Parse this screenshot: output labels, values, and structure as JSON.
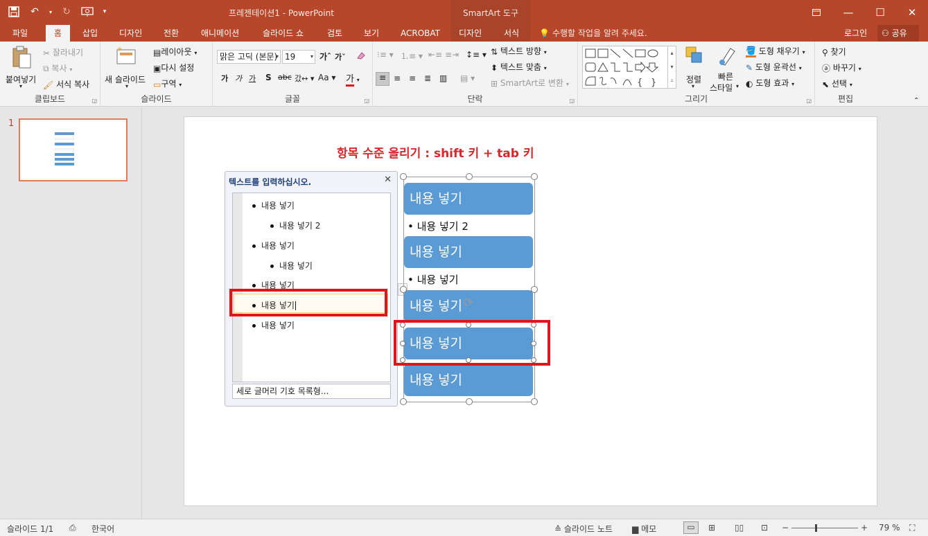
{
  "app": {
    "doc_title": "프레젠테이션1 - PowerPoint",
    "contextual_header": "SmartArt 도구"
  },
  "colors": {
    "accent": "#b7472a",
    "smartart_fill": "#5b9bd5",
    "highlight_box": "#e0141b",
    "title_red": "#d9262b"
  },
  "tabs": [
    {
      "label": "파일"
    },
    {
      "label": "홈"
    },
    {
      "label": "삽입"
    },
    {
      "label": "디자인"
    },
    {
      "label": "전환"
    },
    {
      "label": "애니메이션"
    },
    {
      "label": "슬라이드 쇼"
    },
    {
      "label": "검토"
    },
    {
      "label": "보기"
    },
    {
      "label": "ACROBAT"
    },
    {
      "label": "디자인"
    },
    {
      "label": "서식"
    }
  ],
  "tell_me": "수행할 작업을 알려 주세요.",
  "account": {
    "login": "로그인",
    "share": "공유"
  },
  "ribbon": {
    "clipboard": {
      "paste": "붙여넣기",
      "cut": "잘라내기",
      "copy": "복사",
      "format_painter": "서식 복사",
      "label": "클립보드"
    },
    "slides": {
      "new_slide": "새 슬라이드",
      "layout": "레이아웃",
      "reset": "다시 설정",
      "section": "구역",
      "label": "슬라이드"
    },
    "font": {
      "font_name": "맑은 고딕 (본문)",
      "font_size": "19",
      "label": "글꼴"
    },
    "paragraph": {
      "text_direction": "텍스트 방향",
      "align_text": "텍스트 맞춤",
      "convert_smartart": "SmartArt로 변환",
      "label": "단락"
    },
    "drawing": {
      "arrange": "정렬",
      "quick_styles_1": "빠른",
      "quick_styles_2": "스타일",
      "shape_fill": "도형 채우기",
      "shape_outline": "도형 윤곽선",
      "shape_effects": "도형 효과",
      "label": "그리기"
    },
    "editing": {
      "find": "찾기",
      "replace": "바꾸기",
      "select": "선택",
      "label": "편집"
    }
  },
  "thumbnail": {
    "number": "1"
  },
  "slide": {
    "title": "항목 수준 올리기 : shift 키 + tab 키",
    "text_pane": {
      "title": "텍스트를 입력하십시오.",
      "items": [
        {
          "text": "내용 넣기",
          "level": 1
        },
        {
          "text": "내용 넣기 2",
          "level": 2
        },
        {
          "text": "내용 넣기",
          "level": 1
        },
        {
          "text": "내용 넣기",
          "level": 2
        },
        {
          "text": "내용 넣기",
          "level": 1
        },
        {
          "text": "내용 넣기",
          "level": 1
        },
        {
          "text": "내용 넣기",
          "level": 1
        }
      ],
      "footer": "세로 글머리 기호 목록형..."
    },
    "smartart": {
      "boxes": [
        "내용 넣기",
        "내용 넣기",
        "내용 넣기",
        "내용 넣기",
        "내용 넣기"
      ],
      "subs": [
        "• 내용 넣기 2",
        "• 내용 넣기"
      ]
    }
  },
  "status": {
    "slide_count": "슬라이드 1/1",
    "language": "한국어",
    "notes": "슬라이드 노트",
    "comments": "메모",
    "zoom": "79 %"
  }
}
